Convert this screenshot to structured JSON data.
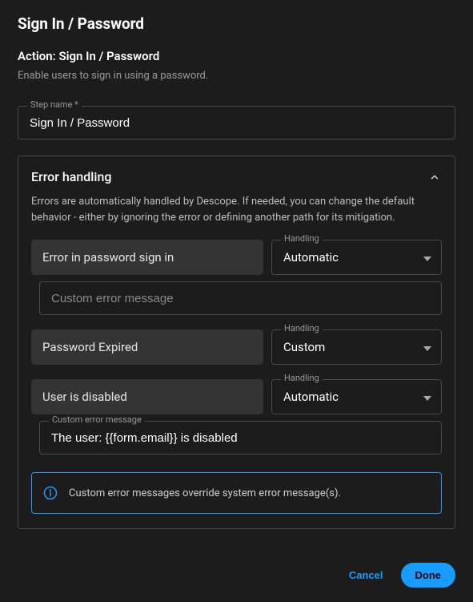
{
  "header": {
    "title": "Sign In / Password"
  },
  "action": {
    "title": "Action: Sign In / Password",
    "description": "Enable users to sign in using a password."
  },
  "step_name": {
    "label": "Step name *",
    "value": "Sign In / Password"
  },
  "error_panel": {
    "title": "Error handling",
    "description": "Errors are automatically handled by Descope. If needed, you can change the default behavior - either by ignoring the error or defining another path for its mitigation.",
    "handling_label": "Handling",
    "custom_msg_label": "Custom error message",
    "custom_msg_placeholder": "Custom error message",
    "items": [
      {
        "name": "Error in password sign in",
        "handling": "Automatic",
        "custom_message": ""
      },
      {
        "name": "Password Expired",
        "handling": "Custom",
        "custom_message": null
      },
      {
        "name": "User is disabled",
        "handling": "Automatic",
        "custom_message": "The user: {{form.email}} is disabled"
      }
    ],
    "banner": "Custom error messages override system error message(s)."
  },
  "footer": {
    "cancel": "Cancel",
    "done": "Done"
  }
}
